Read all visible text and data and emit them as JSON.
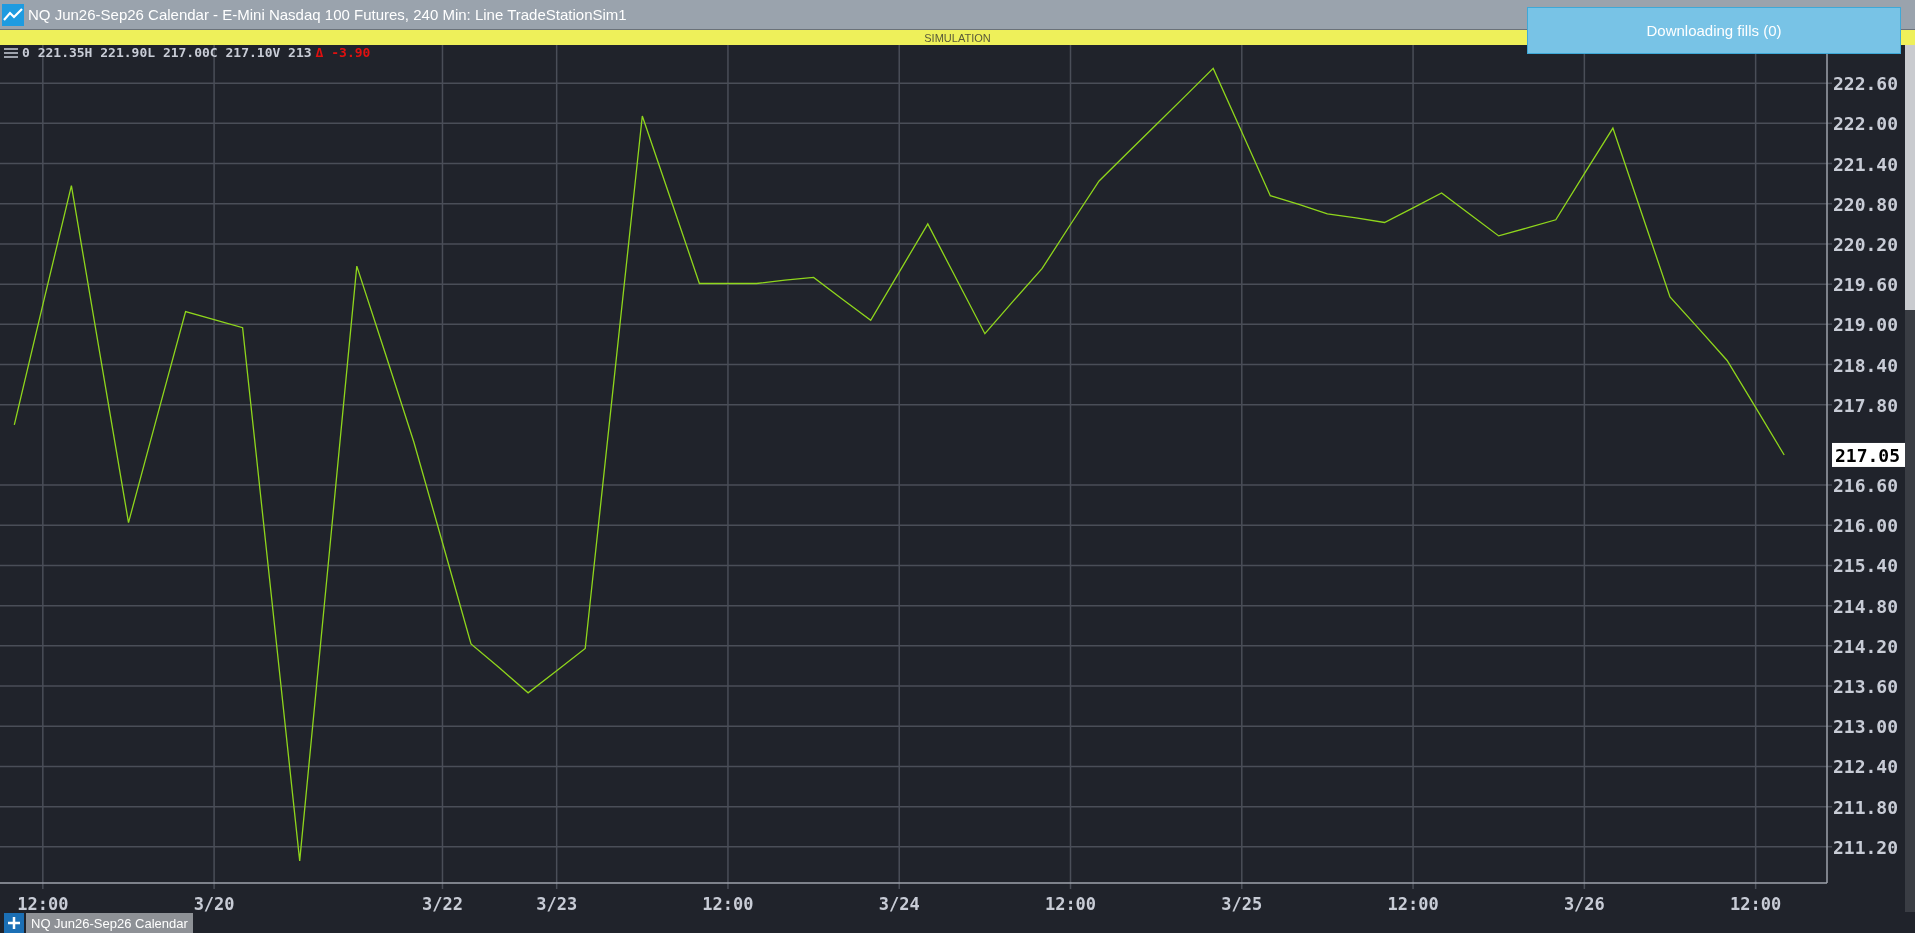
{
  "window": {
    "title": "NQ Jun26-Sep26 Calendar - E-Mini Nasdaq 100 Futures, 240 Min: Line TradeStationSim1"
  },
  "banner": {
    "label": "SIMULATION"
  },
  "toast": {
    "text": "Downloading fills (0)"
  },
  "chart": {
    "legend": {
      "values": "0 221.35H 221.90L 217.00C 217.10V 213",
      "change": "Δ -3.90"
    },
    "last_price": "217.05",
    "chart_data": {
      "type": "line",
      "grid": true,
      "categories": [
        null,
        "12:00",
        null,
        null,
        null,
        null,
        null,
        "3/20",
        null,
        null,
        null,
        null,
        null,
        null,
        null,
        "3/22",
        null,
        null,
        null,
        "3/23",
        null,
        null,
        null,
        null,
        null,
        "12:00",
        null,
        null,
        null,
        null,
        null,
        "3/24",
        null,
        null,
        null,
        null,
        null,
        "12:00",
        null,
        null,
        null,
        null,
        null,
        "3/25",
        null,
        null,
        null,
        null,
        null,
        "12:00",
        null,
        null,
        null,
        null,
        null,
        "3/26",
        null,
        null,
        null,
        null,
        null,
        "12:00",
        null,
        null
      ],
      "series": [
        {
          "color": "#8fd61c",
          "values": [
            217.5,
            219.29,
            221.07,
            218.56,
            216.04,
            217.62,
            219.19,
            219.07,
            218.95,
            214.97,
            210.99,
            215.43,
            219.87,
            218.56,
            217.24,
            215.74,
            214.23,
            213.87,
            213.5,
            213.83,
            214.16,
            218.14,
            222.11,
            220.86,
            219.61,
            219.61,
            219.61,
            219.66,
            219.7,
            219.38,
            219.06,
            219.78,
            220.5,
            219.68,
            218.86,
            219.35,
            219.83,
            220.49,
            221.14,
            221.56,
            221.98,
            222.4,
            222.82,
            221.87,
            220.92,
            220.79,
            220.65,
            220.59,
            220.52,
            220.74,
            220.96,
            220.64,
            220.32,
            220.44,
            220.56,
            221.25,
            221.93,
            220.67,
            219.41,
            218.94,
            218.46,
            217.76,
            217.05,
            null
          ]
        }
      ],
      "ylim": [
        210.66,
        223.17
      ],
      "yticks": [
        {
          "value": 222.6,
          "label": "222.60"
        },
        {
          "value": 222.0,
          "label": "222.00"
        },
        {
          "value": 221.4,
          "label": "221.40"
        },
        {
          "value": 220.8,
          "label": "220.80"
        },
        {
          "value": 220.2,
          "label": "220.20"
        },
        {
          "value": 219.6,
          "label": "219.60"
        },
        {
          "value": 219.0,
          "label": "219.00"
        },
        {
          "value": 218.4,
          "label": "218.40"
        },
        {
          "value": 217.8,
          "label": "217.80"
        },
        {
          "value": 216.6,
          "label": "216.60"
        },
        {
          "value": 216.0,
          "label": "216.00"
        },
        {
          "value": 215.4,
          "label": "215.40"
        },
        {
          "value": 214.8,
          "label": "214.80"
        },
        {
          "value": 214.2,
          "label": "214.20"
        },
        {
          "value": 213.6,
          "label": "213.60"
        },
        {
          "value": 213.0,
          "label": "213.00"
        },
        {
          "value": 212.4,
          "label": "212.40"
        },
        {
          "value": 211.8,
          "label": "211.80"
        },
        {
          "value": 211.2,
          "label": "211.20"
        }
      ]
    }
  },
  "tabs": [
    {
      "label": "NQ Jun26-Sep26 Calendar",
      "selected": true
    }
  ]
}
